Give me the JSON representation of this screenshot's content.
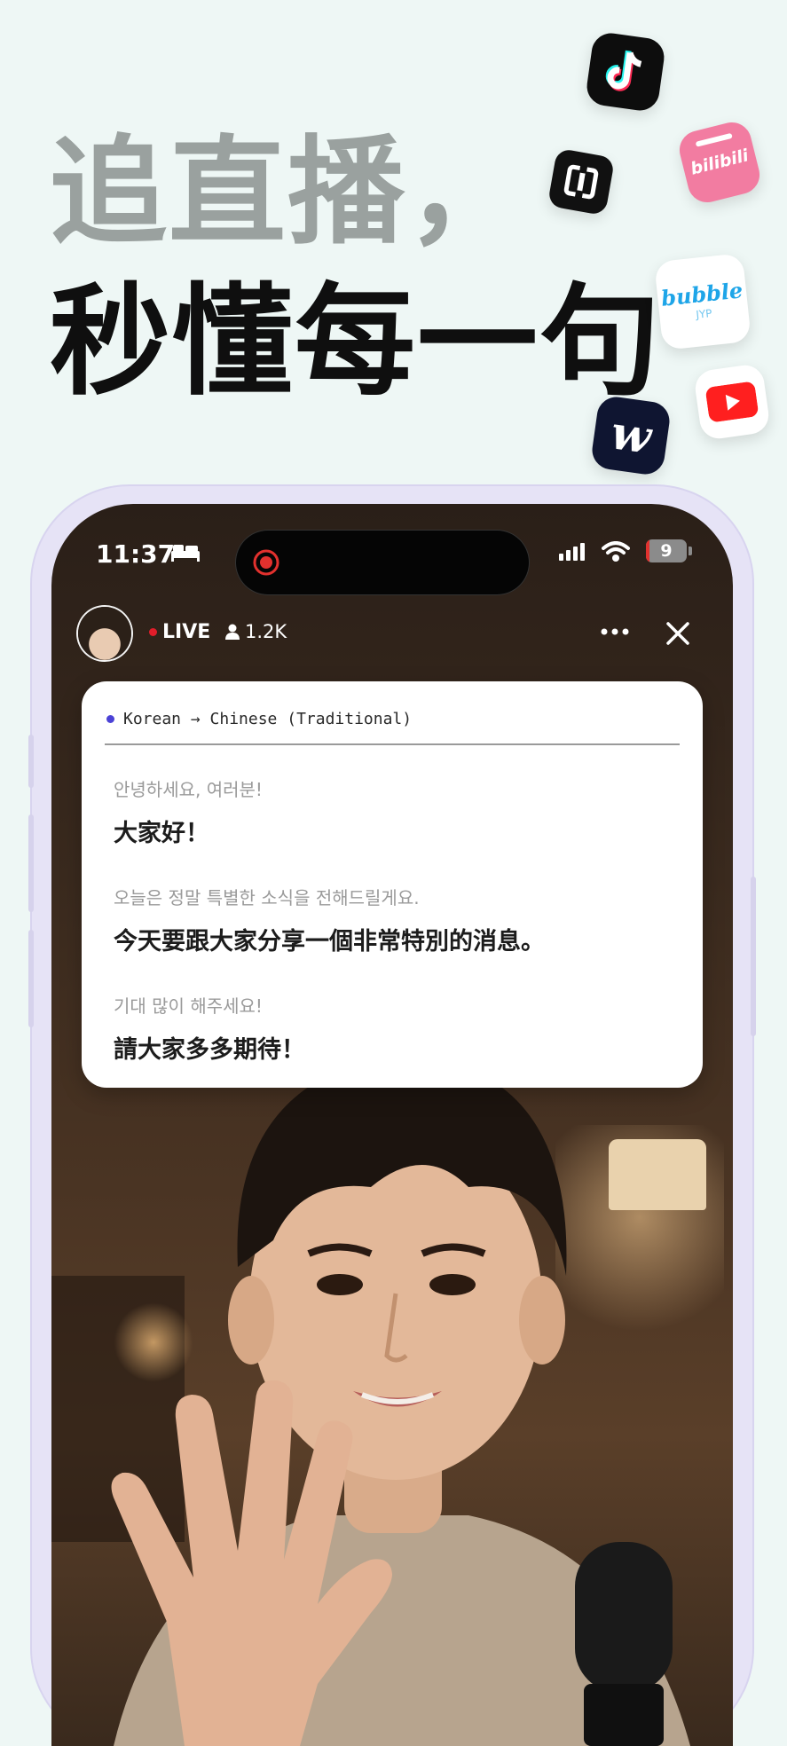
{
  "headline": {
    "line1": "追直播，",
    "line2": "秒懂每一句"
  },
  "app_icons": [
    {
      "name": "tiktok-icon"
    },
    {
      "name": "box-app-icon"
    },
    {
      "name": "bilibili-icon",
      "label": "bilibili"
    },
    {
      "name": "bubble-icon",
      "label": "bubble",
      "sublabel": "JYP"
    },
    {
      "name": "youtube-icon"
    },
    {
      "name": "weverse-icon",
      "label": "w"
    }
  ],
  "status_bar": {
    "time": "11:37",
    "battery": "9",
    "battery_level": 0.09
  },
  "live": {
    "label": "LIVE",
    "viewers": "1.2K"
  },
  "translation_card": {
    "language_pair": "Korean → Chinese (Traditional)",
    "lines": [
      {
        "source": "안녕하세요, 여러분!",
        "translation": "大家好！"
      },
      {
        "source": "오늘은 정말 특별한 소식을 전해드릴게요.",
        "translation": "今天要跟大家分享一個非常特別的消息。"
      },
      {
        "source": "기대 많이 해주세요!",
        "translation": "請大家多多期待！"
      }
    ]
  },
  "colors": {
    "background": "#eef7f5",
    "headline_gray": "#9aa19f",
    "live_red": "#e11d2a",
    "language_dot": "#4b42d6",
    "phone_frame": "#e6e3f6"
  }
}
